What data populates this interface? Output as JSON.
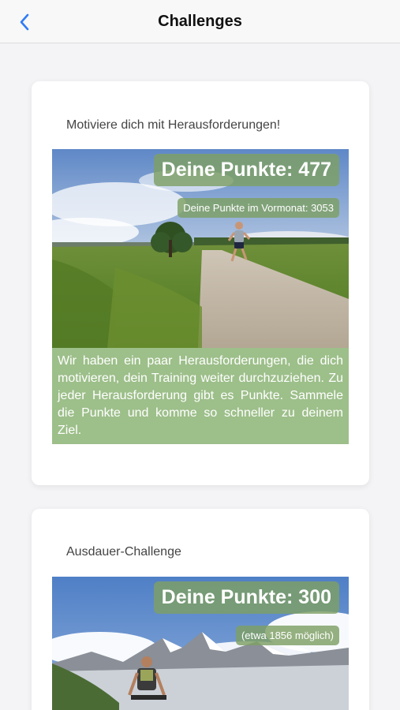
{
  "navbar": {
    "title": "Challenges"
  },
  "cards": [
    {
      "heading": "Motiviere dich mit Herausforderungen!",
      "points": "Deine Punkte: 477",
      "sub_badge": "Deine Punkte im Vormonat: 3053",
      "description": "Wir haben ein paar Herausforderungen, die dich motivieren, dein Training weiter durchzuziehen. Zu jeder Herausforderung gibt es Punkte. Sammele die Punkte und komme so schneller zu deinem Ziel."
    },
    {
      "heading": "Ausdauer-Challenge",
      "points": "Deine Punkte: 300",
      "sub_badge": "(etwa 1856 möglich)"
    }
  ],
  "colors": {
    "accent": "#2f7cf6",
    "badge": "#7ea064",
    "desc_bg": "#9dbf8a"
  },
  "icons": {
    "back": "chevron-left-icon"
  }
}
